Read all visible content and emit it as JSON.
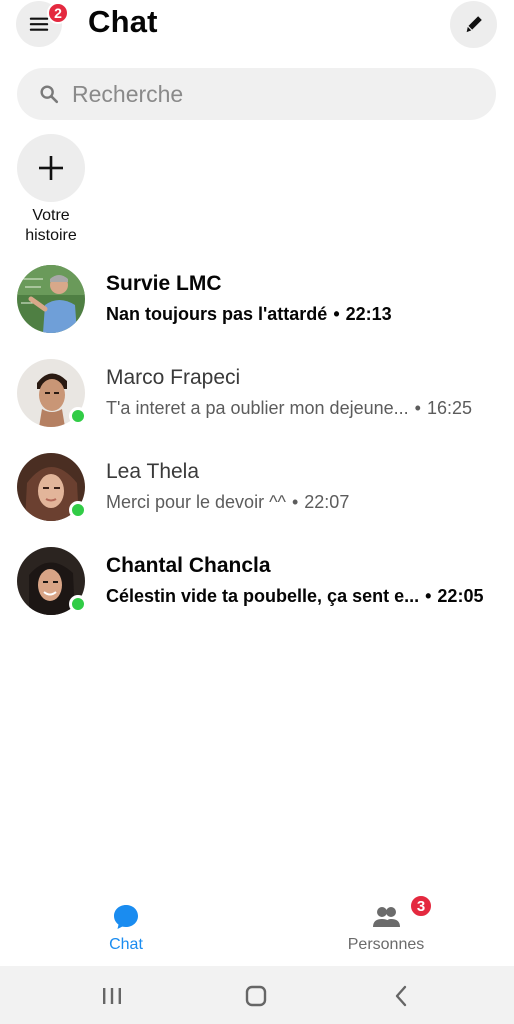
{
  "header": {
    "title": "Chat",
    "menu_badge": "2",
    "menu_icon": "hamburger-icon",
    "compose_icon": "pencil-icon"
  },
  "search": {
    "placeholder": "Recherche",
    "icon": "search-icon"
  },
  "story": {
    "label_line1": "Votre",
    "label_line2": "histoire",
    "icon": "plus-icon"
  },
  "conversations": [
    {
      "name": "Survie LMC",
      "preview": "Nan toujours pas l'attardé",
      "time": "22:13",
      "unread": true,
      "online": false,
      "avatar_color": "#5a8a4a"
    },
    {
      "name": "Marco Frapeci",
      "preview": "T'a interet a pa oublier mon dejeune...",
      "time": "16:25",
      "unread": false,
      "online": true,
      "avatar_color": "#b08468"
    },
    {
      "name": "Lea Thela",
      "preview": "Merci pour le devoir ^^",
      "time": "22:07",
      "unread": false,
      "online": true,
      "avatar_color": "#6a4232"
    },
    {
      "name": "Chantal Chancla",
      "preview": "Célestin vide ta poubelle, ça sent e...",
      "time": "22:05",
      "unread": true,
      "online": true,
      "avatar_color": "#3a2a24"
    }
  ],
  "separator": "•",
  "bottom_nav": {
    "chat_label": "Chat",
    "people_label": "Personnes",
    "people_badge": "3",
    "active_color": "#1a8cf0",
    "inactive_color": "#6b6b6b"
  },
  "colors": {
    "badge": "#e4293f",
    "online": "#31cc46",
    "accent": "#1a8cf0"
  }
}
